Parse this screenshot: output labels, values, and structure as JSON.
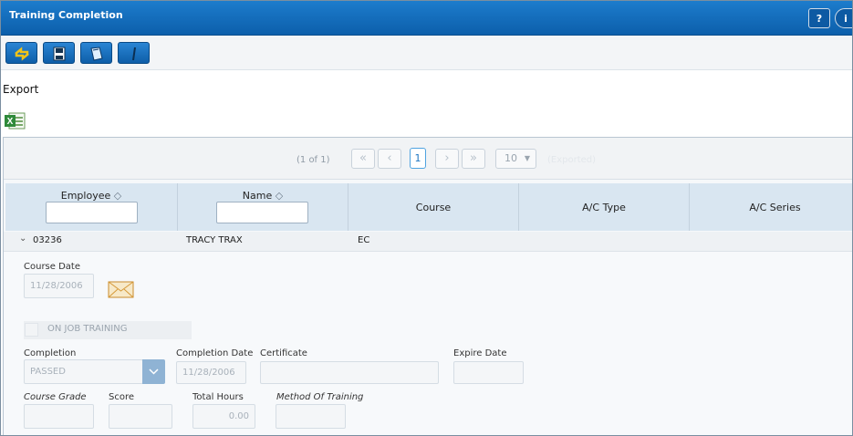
{
  "window": {
    "title": "Training Completion",
    "help_label": "?",
    "info_label": "i"
  },
  "toolbar": {
    "buttons": [
      "refresh-icon",
      "save-icon",
      "book-icon",
      "pen-icon"
    ]
  },
  "export": {
    "label": "Export",
    "excel_icon": "excel-icon"
  },
  "pager": {
    "info": "(1 of 1)",
    "current_page": "1",
    "page_size": "10",
    "exported_label": "(Exported)"
  },
  "grid": {
    "columns": {
      "employee": "Employee",
      "name": "Name",
      "course": "Course",
      "ac_type": "A/C Type",
      "ac_series": "A/C Series"
    },
    "row": {
      "employee": "03236",
      "name": "TRACY TRAX",
      "course": "EC",
      "ac_type": "",
      "ac_series": ""
    }
  },
  "detail": {
    "course_date_label": "Course Date",
    "course_date_value": "11/28/2006",
    "on_job_training_label": "ON JOB TRAINING",
    "completion_label": "Completion",
    "completion_value": "PASSED",
    "completion_date_label": "Completion Date",
    "completion_date_value": "11/28/2006",
    "certificate_label": "Certificate",
    "certificate_value": "",
    "expire_date_label": "Expire Date",
    "expire_date_value": "",
    "course_grade_label": "Course Grade",
    "score_label": "Score",
    "total_hours_label": "Total Hours",
    "total_hours_value": "0.00",
    "method_label": "Method Of Training"
  },
  "colors": {
    "titlebar": "#0c5fab",
    "header_bg": "#d9e6f1",
    "accent": "#1d75c2"
  }
}
